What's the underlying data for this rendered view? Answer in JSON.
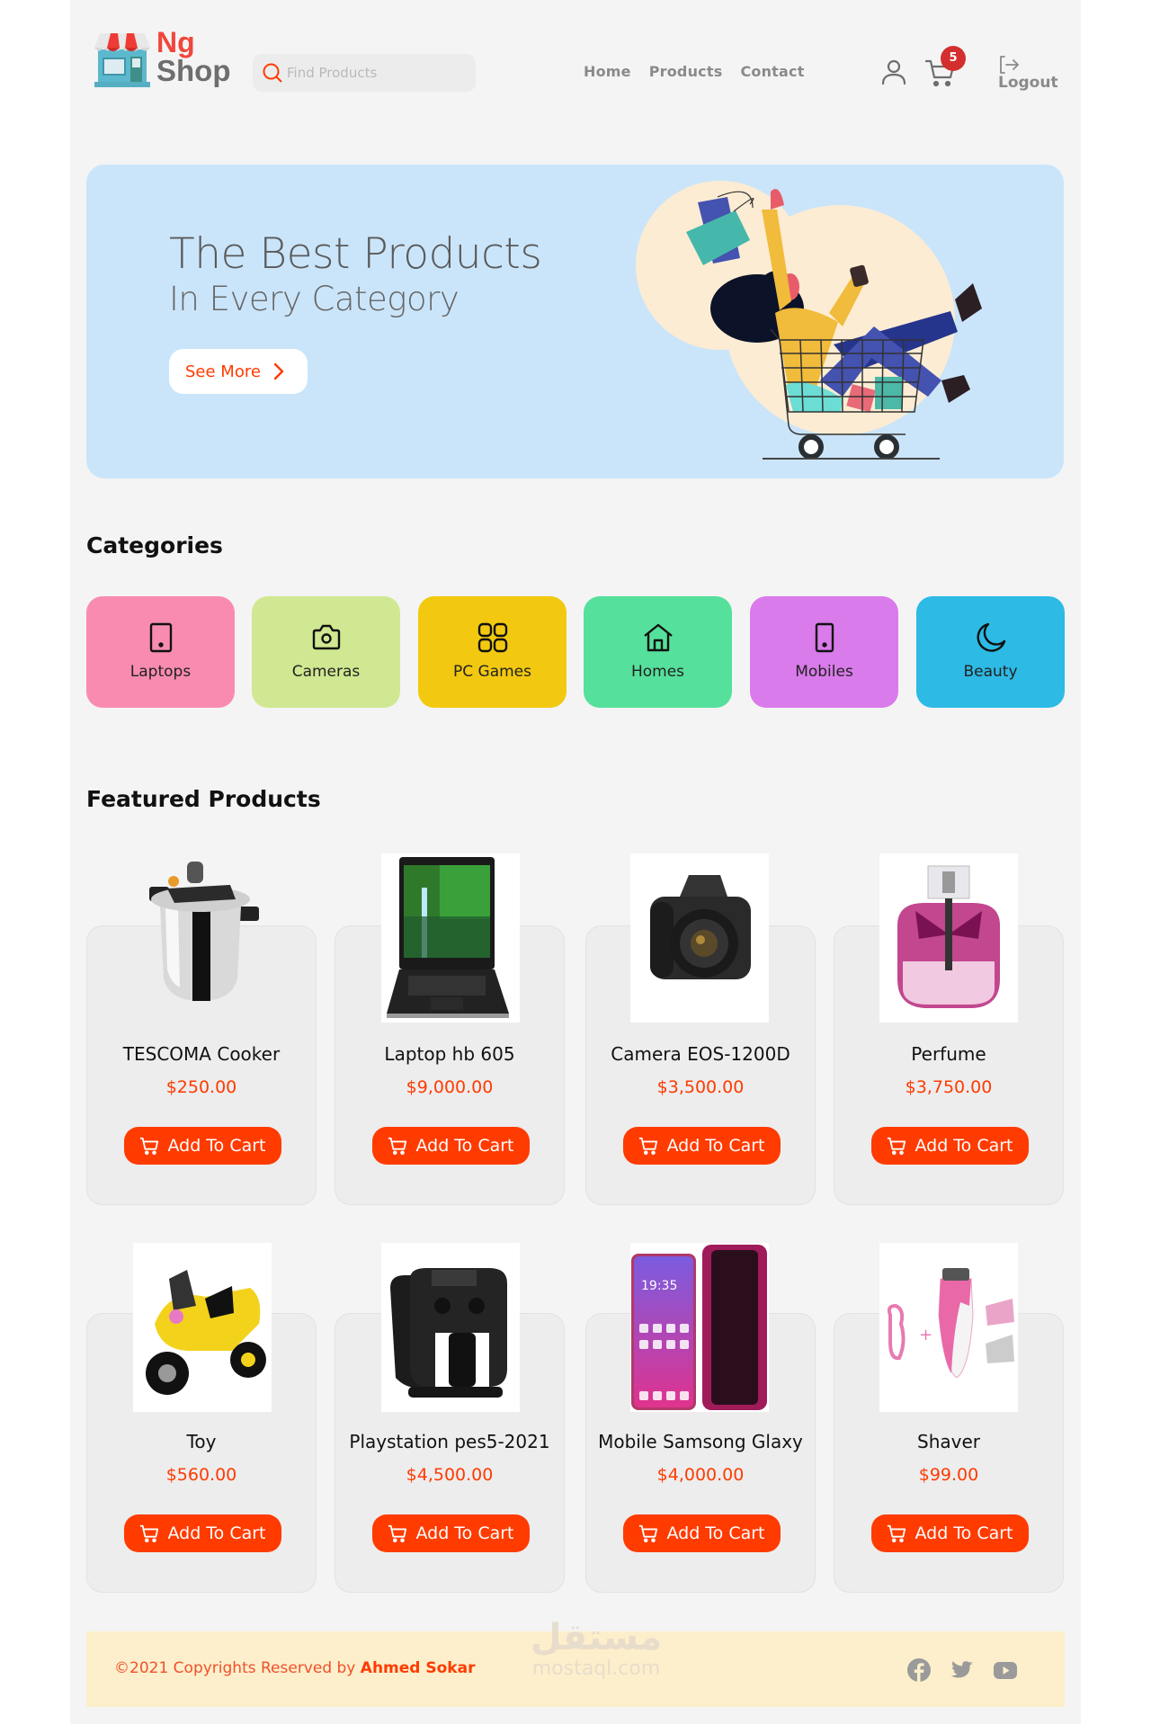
{
  "header": {
    "logo_line1": "Ng",
    "logo_line2": "Shop",
    "search_placeholder": "Find Products",
    "search_value": "",
    "nav": [
      {
        "label": "Home"
      },
      {
        "label": "Products"
      },
      {
        "label": "Contact"
      }
    ],
    "cart_count": "5",
    "logout_label": "Logout"
  },
  "hero": {
    "title": "The Best Products",
    "subtitle": "In Every Category",
    "cta_label": "See More"
  },
  "categories": {
    "title": "Categories",
    "items": [
      {
        "label": "Laptops",
        "icon": "tablet-icon",
        "color": "#f98bb0"
      },
      {
        "label": "Cameras",
        "icon": "camera-icon",
        "color": "#d0e891"
      },
      {
        "label": "PC Games",
        "icon": "grid-icon",
        "color": "#f2c910"
      },
      {
        "label": "Homes",
        "icon": "home-icon",
        "color": "#55e09b"
      },
      {
        "label": "Mobiles",
        "icon": "mobile-icon",
        "color": "#d97bea"
      },
      {
        "label": "Beauty",
        "icon": "moon-icon",
        "color": "#2dbae5"
      }
    ]
  },
  "featured": {
    "title": "Featured Products",
    "add_to_cart_label": "Add To Cart",
    "products": [
      {
        "name": "TESCOMA Cooker",
        "price": "$250.00",
        "image": "pressure-cooker"
      },
      {
        "name": "Laptop hb 605",
        "price": "$9,000.00",
        "image": "laptop"
      },
      {
        "name": "Camera EOS-1200D",
        "price": "$3,500.00",
        "image": "dslr-camera"
      },
      {
        "name": "Perfume",
        "price": "$3,750.00",
        "image": "perfume-bottle"
      },
      {
        "name": "Toy",
        "price": "$560.00",
        "image": "toy-motorbike"
      },
      {
        "name": "Playstation pes5-2021",
        "price": "$4,500.00",
        "image": "controller-charger"
      },
      {
        "name": "Mobile Samsong Glaxy",
        "price": "$4,000.00",
        "image": "smartphone"
      },
      {
        "name": "Shaver",
        "price": "$99.00",
        "image": "lady-shaver"
      }
    ]
  },
  "footer": {
    "copyright_prefix": "©2021 Copyrights Reserved by ",
    "author": "Ahmed Sokar",
    "watermark_ar": "مستقل",
    "watermark_en": "mostaql.com",
    "socials": [
      "facebook",
      "twitter",
      "youtube"
    ]
  },
  "colors": {
    "accent": "#ff3b00",
    "hero_bg": "#cae5fa",
    "footer_bg": "#fdefcb",
    "badge": "#d32f2f"
  }
}
